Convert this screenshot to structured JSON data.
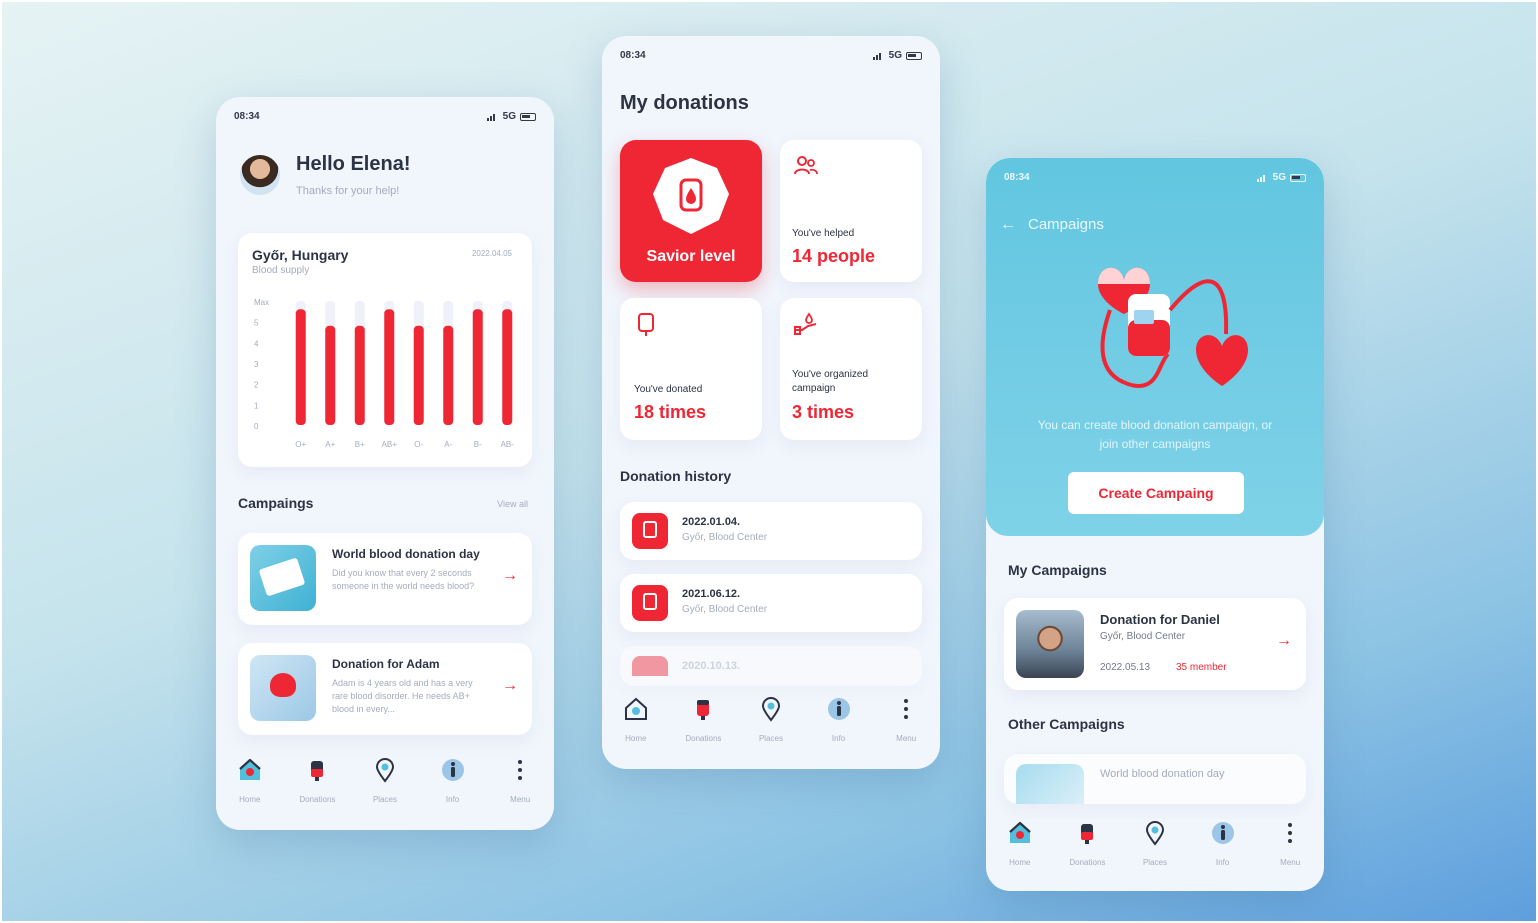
{
  "colors": {
    "accent": "#ef2735",
    "teal": "#52c0dc",
    "dark": "#2b3344",
    "muted": "#a4adbd",
    "card": "#ffffff"
  },
  "status": {
    "time": "08:34",
    "network": "5G"
  },
  "screen1": {
    "greeting": "Hello Elena!",
    "subtitle": "Thanks for your help!",
    "supply_card": {
      "location": "Győr, Hungary",
      "caption": "Blood supply",
      "date": "2022.04.05"
    },
    "campaigns_title": "Campaings",
    "view_all": "View all",
    "campaigns": [
      {
        "title": "World blood donation day",
        "desc": "Did you know that every 2 seconds someone in the world needs blood?"
      },
      {
        "title": "Donation for Adam",
        "desc": "Adam is 4 years old and has a very rare blood disorder. He needs AB+ blood in every..."
      }
    ]
  },
  "chart_data": {
    "type": "bar",
    "title": "Blood supply",
    "categories": [
      "O+",
      "A+",
      "B+",
      "AB+",
      "O-",
      "A-",
      "B-",
      "AB-"
    ],
    "values": [
      5.6,
      4.8,
      4.8,
      5.6,
      4.8,
      4.8,
      5.6,
      5.6
    ],
    "y_ticks": [
      "Max",
      "5",
      "4",
      "3",
      "2",
      "1",
      "0"
    ],
    "ylim": [
      0,
      6
    ],
    "grid": false
  },
  "screen2": {
    "title": "My donations",
    "savior_label": "Savior level",
    "helped_caption": "You've helped",
    "helped_value": "14 people",
    "donated_caption": "You've donated",
    "donated_value": "18 times",
    "organized_caption": "You've organized campaign",
    "organized_value": "3 times",
    "history_title": "Donation history",
    "history": [
      {
        "date": "2022.01.04.",
        "place": "Győr, Blood Center"
      },
      {
        "date": "2021.06.12.",
        "place": "Győr, Blood Center"
      },
      {
        "date": "2020.10.13.",
        "place": ""
      }
    ]
  },
  "screen3": {
    "back_label": "Campaigns",
    "hero_text": "You can create blood donation campaign, or join other campaigns",
    "create_button": "Create Campaing",
    "my_title": "My Campaigns",
    "my_campaign": {
      "title": "Donation for Daniel",
      "place": "Győr, Blood Center",
      "date": "2022.05.13",
      "members": "35 member"
    },
    "other_title": "Other Campaigns",
    "other_campaign": "World blood donation day"
  },
  "nav": {
    "home": "Home",
    "donations": "Donations",
    "places": "Places",
    "info": "Info",
    "menu": "Menu"
  }
}
